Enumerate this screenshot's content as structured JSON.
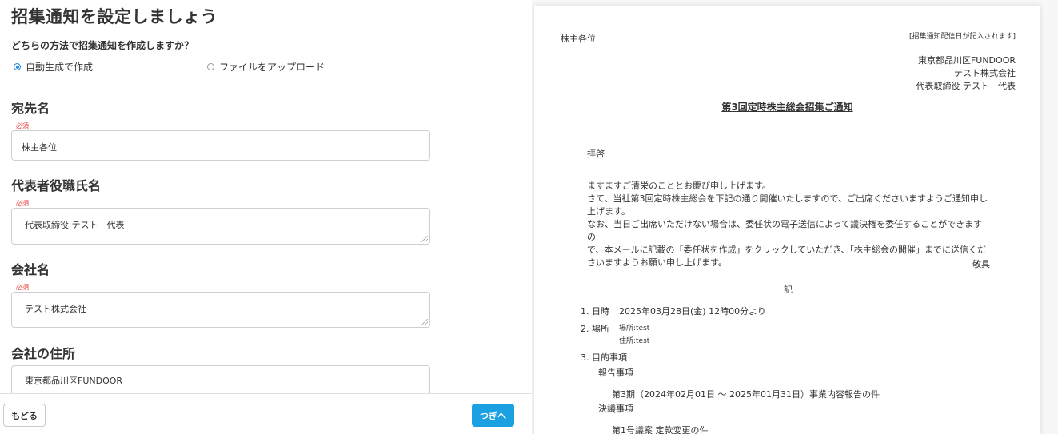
{
  "form": {
    "title": "招集通知を設定しましょう",
    "question": "どちらの方法で招集通知を作成しますか？",
    "options": [
      {
        "label": "自動生成で作成",
        "selected": true
      },
      {
        "label": "ファイルをアップロード",
        "selected": false
      }
    ],
    "required_label": "必須",
    "fields": [
      {
        "label": "宛先名",
        "value": "株主各位"
      },
      {
        "label": "代表者役職氏名",
        "value": "代表取締役 テスト　代表"
      },
      {
        "label": "会社名",
        "value": "テスト株式会社"
      },
      {
        "label": "会社の住所",
        "value": "東京都品川区FUNDOOR"
      }
    ]
  },
  "footer": {
    "back_label": "もどる",
    "next_label": "つぎへ",
    "accent_color": "#1ba1e2"
  },
  "preview": {
    "recipient": "株主各位",
    "date_note": "[招集通知配信日が記入されます]",
    "address": "東京都品川区FUNDOOR",
    "company": "テスト株式会社",
    "representative": "代表取締役 テスト　代表",
    "title": "第3回定時株主総会招集ご通知",
    "greeting": "拝啓",
    "paragraphs": [
      "ますますご清栄のこととお慶び申し上げます。",
      "さて、当社第3回定時株主総会を下記の通り開催いたしますので、ご出席くださいますようご通知申し",
      "上げます。",
      "なお、当日ご出席いただけない場合は、委任状の電子送信によって議決権を委任することができますの",
      "で、本メールに記載の「委任状を作成」をクリックしていただき、「株主総会の開催」までに送信くだ",
      "さいますようお願い申し上げます。"
    ],
    "closing": "敬具",
    "ki": "記",
    "item1_label": "1. 日時",
    "item1_value": "2025年03月28日(金) 12時00分より",
    "item2_label": "2. 場所",
    "item2_place": "場所:test",
    "item2_address": "住所:test",
    "item3_label": "3. 目的事項",
    "report_heading": "報告事項",
    "report_item": "第3期（2024年02月01日 〜 2025年01月31日）事業内容報告の件",
    "resolution_heading": "決議事項",
    "resolution_item": "第1号議案 定款変更の件"
  }
}
